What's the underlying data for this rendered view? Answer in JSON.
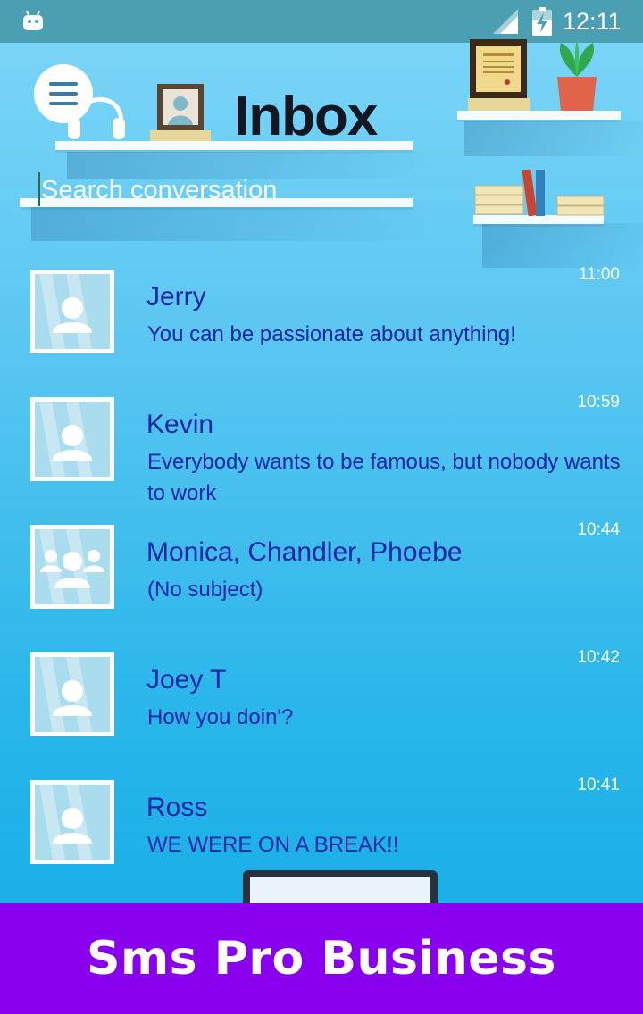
{
  "status_bar": {
    "time": "12:11",
    "icons": [
      "android-icon",
      "signal-icon",
      "battery-charging-icon"
    ]
  },
  "header": {
    "title": "Inbox",
    "menu_icon": "hamburger-menu-icon",
    "decor_icons": [
      "headphones-icon",
      "picture-frame-icon",
      "certificate-frame-icon",
      "potted-plant-icon",
      "books-icon"
    ]
  },
  "search": {
    "placeholder": "Search conversation"
  },
  "conversations": [
    {
      "name": "Jerry",
      "message": " You can be passionate about anything!",
      "time": "11:00",
      "avatar": "single-user-icon"
    },
    {
      "name": "Kevin",
      "message": " Everybody wants to be famous, but nobody wants to work",
      "time": "10:59",
      "avatar": "single-user-icon"
    },
    {
      "name": "Monica, Chandler, Phoebe",
      "message": "(No subject)",
      "time": "10:44",
      "avatar": "group-users-icon"
    },
    {
      "name": "Joey T",
      "message": "How you doin'?",
      "time": "10:42",
      "avatar": "single-user-icon"
    },
    {
      "name": "Ross",
      "message": "WE WERE ON A BREAK!!",
      "time": "10:41",
      "avatar": "single-user-icon"
    }
  ],
  "banner": {
    "text": "Sms Pro Business",
    "color": "#8800ee"
  },
  "colors": {
    "accent_text": "#1a25a8",
    "status_bar": "#4aa0b2"
  }
}
